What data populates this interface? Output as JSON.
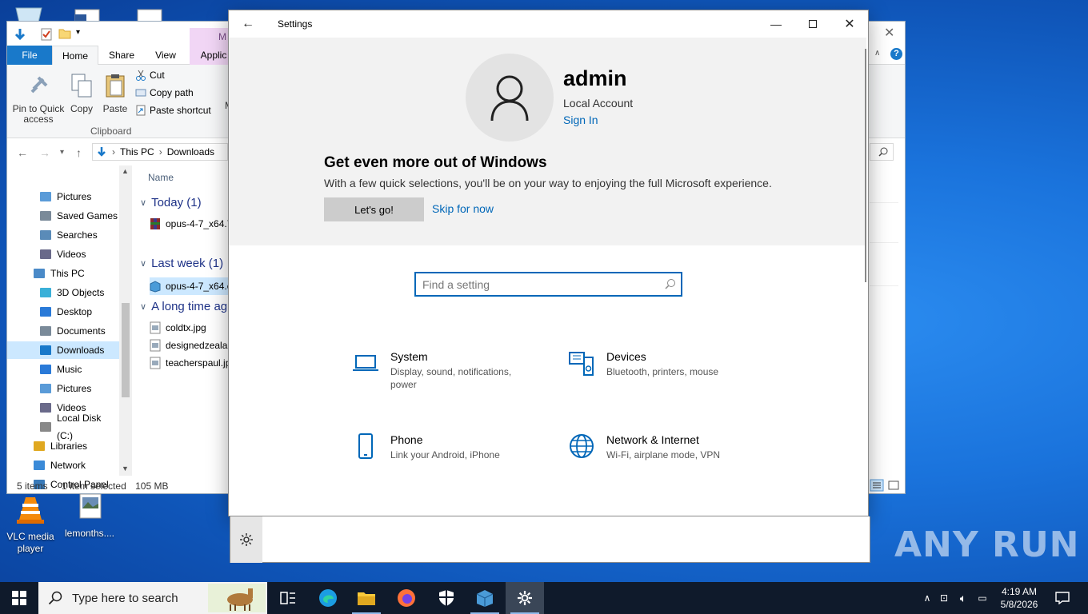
{
  "desktop": {
    "icons": [
      {
        "label": "VLC media player",
        "name": "vlc-desktop-icon"
      },
      {
        "label": "lemonths....",
        "name": "lemonths-desktop-icon"
      }
    ],
    "watermark": "ANY RUN"
  },
  "explorer": {
    "tabs": {
      "file": "File",
      "home": "Home",
      "share": "Share",
      "view": "View",
      "app_tools": "Applic",
      "manage": "M"
    },
    "ribbon": {
      "pin": "Pin to Quick access",
      "copy": "Copy",
      "paste": "Paste",
      "cut": "Cut",
      "copy_path": "Copy path",
      "paste_shortcut": "Paste shortcut",
      "clipboard_group": "Clipboard",
      "clipped_letter": "M"
    },
    "breadcrumb": [
      "This PC",
      "Downloads"
    ],
    "nav": [
      {
        "label": "Pictures"
      },
      {
        "label": "Saved Games"
      },
      {
        "label": "Searches"
      },
      {
        "label": "Videos"
      },
      {
        "label": "This PC"
      },
      {
        "label": "3D Objects"
      },
      {
        "label": "Desktop"
      },
      {
        "label": "Documents"
      },
      {
        "label": "Downloads",
        "selected": true
      },
      {
        "label": "Music"
      },
      {
        "label": "Pictures"
      },
      {
        "label": "Videos"
      },
      {
        "label": "Local Disk (C:)"
      },
      {
        "label": "Libraries"
      },
      {
        "label": "Network"
      },
      {
        "label": "Control Panel"
      }
    ],
    "column_name": "Name",
    "groups": [
      {
        "label": "Today (1)",
        "files": [
          "opus-4-7_x64.7"
        ]
      },
      {
        "label": "Last week (1)",
        "files": [
          "opus-4-7_x64.e"
        ]
      },
      {
        "label": "A long time ag",
        "files": [
          "coldtx.jpg",
          "designedzealar",
          "teacherspaul.jp"
        ]
      }
    ],
    "status": {
      "items": "5 items",
      "selected": "1 item selected",
      "size": "105 MB"
    }
  },
  "settings": {
    "window_title": "Settings",
    "user": {
      "name": "admin",
      "account_type": "Local Account",
      "sign_in": "Sign In"
    },
    "promo": {
      "heading": "Get even more out of Windows",
      "body": "With a few quick selections, you'll be on your way to enjoying the full Microsoft experience.",
      "primary": "Let's go!",
      "secondary": "Skip for now"
    },
    "search_placeholder": "Find a setting",
    "categories": [
      {
        "title": "System",
        "subtitle": "Display, sound, notifications, power",
        "icon": "laptop-icon"
      },
      {
        "title": "Devices",
        "subtitle": "Bluetooth, printers, mouse",
        "icon": "devices-icon"
      },
      {
        "title": "Phone",
        "subtitle": "Link your Android, iPhone",
        "icon": "phone-icon"
      },
      {
        "title": "Network & Internet",
        "subtitle": "Wi-Fi, airplane mode, VPN",
        "icon": "globe-icon"
      }
    ]
  },
  "taskbar": {
    "search_placeholder": "Type here to search",
    "time": "4:19 AM",
    "date": "5/8/2026"
  }
}
